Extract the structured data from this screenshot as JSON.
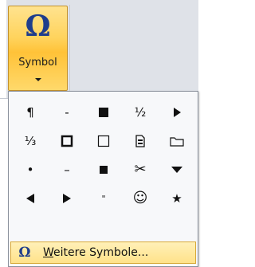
{
  "ribbon": {
    "symbol_button": {
      "icon": "omega-icon",
      "glyph": "Ω",
      "label": "Symbol"
    }
  },
  "symbol_menu": {
    "symbols": [
      {
        "glyph": "¶",
        "icon": "pilcrow"
      },
      {
        "glyph": "-",
        "icon": "hyphen"
      },
      {
        "glyph": "",
        "icon": "black-square"
      },
      {
        "glyph": "½",
        "icon": "one-half"
      },
      {
        "glyph": "",
        "icon": "right-pointing-triangle"
      },
      {
        "glyph": "⅓",
        "icon": "one-third"
      },
      {
        "glyph": "",
        "icon": "bold-hollow-square"
      },
      {
        "glyph": "",
        "icon": "hollow-square"
      },
      {
        "glyph": "",
        "icon": "document"
      },
      {
        "glyph": "",
        "icon": "folder"
      },
      {
        "glyph": "•",
        "icon": "bullet"
      },
      {
        "glyph": "–",
        "icon": "en-dash"
      },
      {
        "glyph": "",
        "icon": "small-black-square"
      },
      {
        "glyph": "✂",
        "icon": "scissors"
      },
      {
        "glyph": "",
        "icon": "down-pointing-triangle"
      },
      {
        "glyph": "",
        "icon": "left-pointing-triangle"
      },
      {
        "glyph": "",
        "icon": "right-pointing-triangle"
      },
      {
        "glyph": "\"",
        "icon": "double-quote"
      },
      {
        "glyph": "☺",
        "icon": "smiley"
      },
      {
        "glyph": "★",
        "icon": "star"
      }
    ],
    "more_symbols": {
      "glyph": "Ω",
      "access_key": "W",
      "label_rest": "eitere Symbole..."
    }
  }
}
